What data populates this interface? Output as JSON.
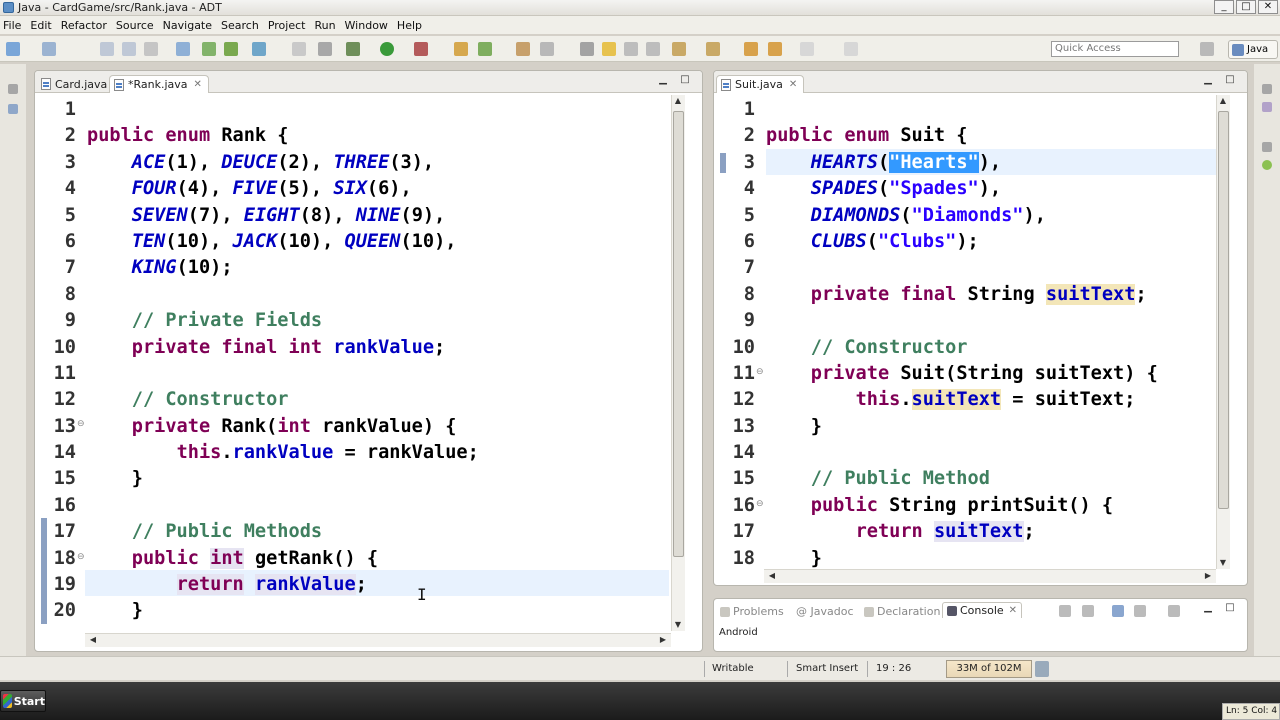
{
  "window": {
    "title": "Java - CardGame/src/Rank.java - ADT",
    "controls": [
      "_",
      "□",
      "✕"
    ]
  },
  "menu": [
    "File",
    "Edit",
    "Refactor",
    "Source",
    "Navigate",
    "Search",
    "Project",
    "Run",
    "Window",
    "Help"
  ],
  "toolbar": {
    "quick_access_placeholder": "Quick Access",
    "perspective": "Java"
  },
  "left_editor": {
    "tabs": [
      {
        "label": "Card.java"
      },
      {
        "label": "*Rank.java"
      }
    ],
    "lines": [
      "1",
      "2",
      "3",
      "4",
      "5",
      "6",
      "7",
      "8",
      "9",
      "10",
      "11",
      "12",
      "13",
      "14",
      "15",
      "16",
      "17",
      "18",
      "19",
      "20"
    ]
  },
  "right_editor": {
    "tabs": [
      {
        "label": "Suit.java"
      }
    ],
    "lines": [
      "1",
      "2",
      "3",
      "4",
      "5",
      "6",
      "7",
      "8",
      "9",
      "10",
      "11",
      "12",
      "13",
      "14",
      "15",
      "16",
      "17",
      "18"
    ]
  },
  "console": {
    "tabs": [
      "Problems",
      "@ Javadoc",
      "Declaration",
      "Console"
    ],
    "label": "Android"
  },
  "status": {
    "writable": "Writable",
    "insert_mode": "Smart Insert",
    "position": "19 : 26",
    "heap": "33M of 102M"
  },
  "taskbar": {
    "start": "Start",
    "tray": "Ln: 5 Col: 4"
  }
}
